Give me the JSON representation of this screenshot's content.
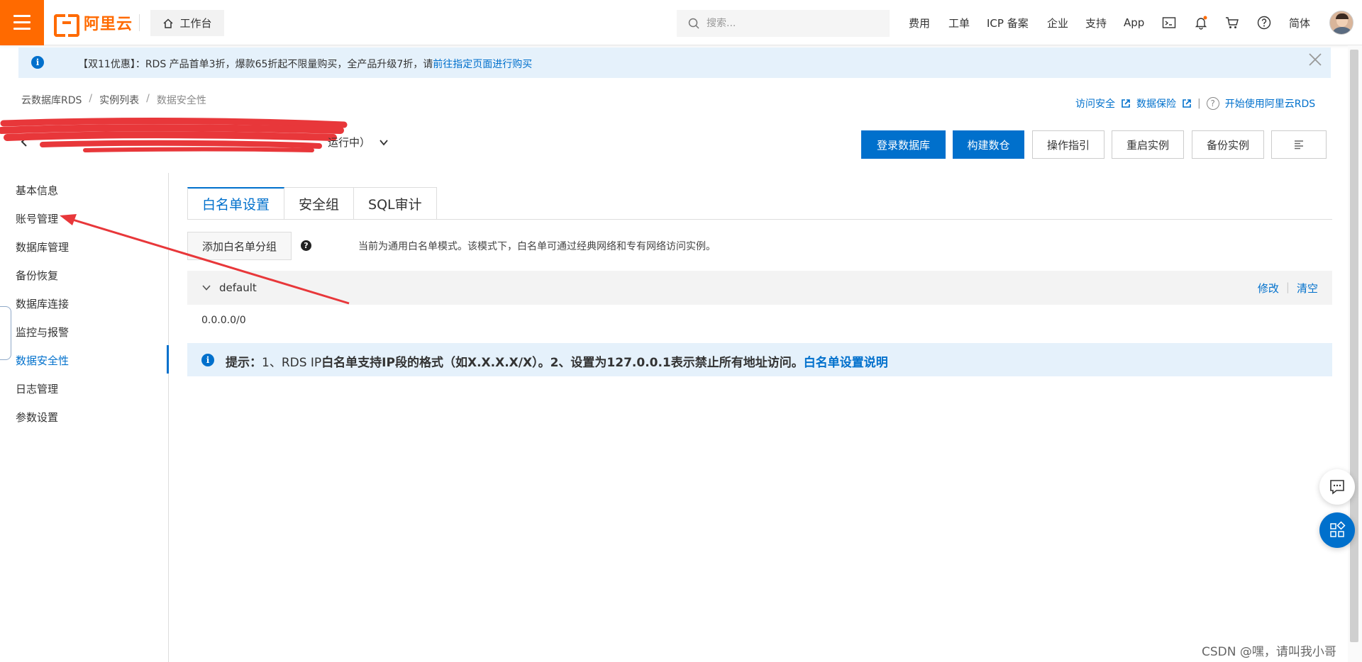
{
  "header": {
    "logo_text": "阿里云",
    "workbench_label": "工作台",
    "search_placeholder": "搜索...",
    "nav": [
      "费用",
      "工单",
      "ICP 备案",
      "企业",
      "支持",
      "App"
    ],
    "lang": "简体",
    "icons": [
      "terminal-icon",
      "bell-icon",
      "cart-icon",
      "help-icon"
    ],
    "accent": "#ff6a00"
  },
  "promo": {
    "prefix": "【双11优惠】：RDS 产品首单3折，爆款65折起不限量购买，全产品升级7折，请",
    "link": "前往指定页面进行购买"
  },
  "breadcrumb": [
    "云数据库RDS",
    "实例列表",
    "数据安全性"
  ],
  "top_links": {
    "access_security": "访问安全",
    "data_protection": "数据保险",
    "get_started": "开始使用阿里云RDS"
  },
  "instance": {
    "status": "运行中）"
  },
  "actions": [
    "登录数据库",
    "构建数仓",
    "操作指引",
    "重启实例",
    "备份实例"
  ],
  "sidebar": {
    "items": [
      "基本信息",
      "账号管理",
      "数据库管理",
      "备份恢复",
      "数据库连接",
      "监控与报警",
      "数据安全性",
      "日志管理",
      "参数设置"
    ],
    "active": "数据安全性"
  },
  "tabs": [
    "白名单设置",
    "安全组",
    "SQL审计"
  ],
  "whitelist": {
    "add_group": "添加白名单分组",
    "mode_text": "当前为通用白名单模式。该模式下，白名单可通过经典网络和专有网络访问实例。",
    "group_name": "default",
    "edit": "修改",
    "clear": "清空",
    "ip": "0.0.0.0/0"
  },
  "tip": {
    "label": "提示：",
    "part1": "1、RDS IP",
    "part2": "白名单支持IP段的格式（如X.X.X.X/X）。2、设置为127.0.0.1表示禁止所有地址访问。",
    "link": "白名单设置说明"
  },
  "watermark": "CSDN @嘿，请叫我小哥",
  "colors": {
    "primary": "#0070cc",
    "orange": "#ff6a00",
    "annotation_red": "#e8373a"
  }
}
